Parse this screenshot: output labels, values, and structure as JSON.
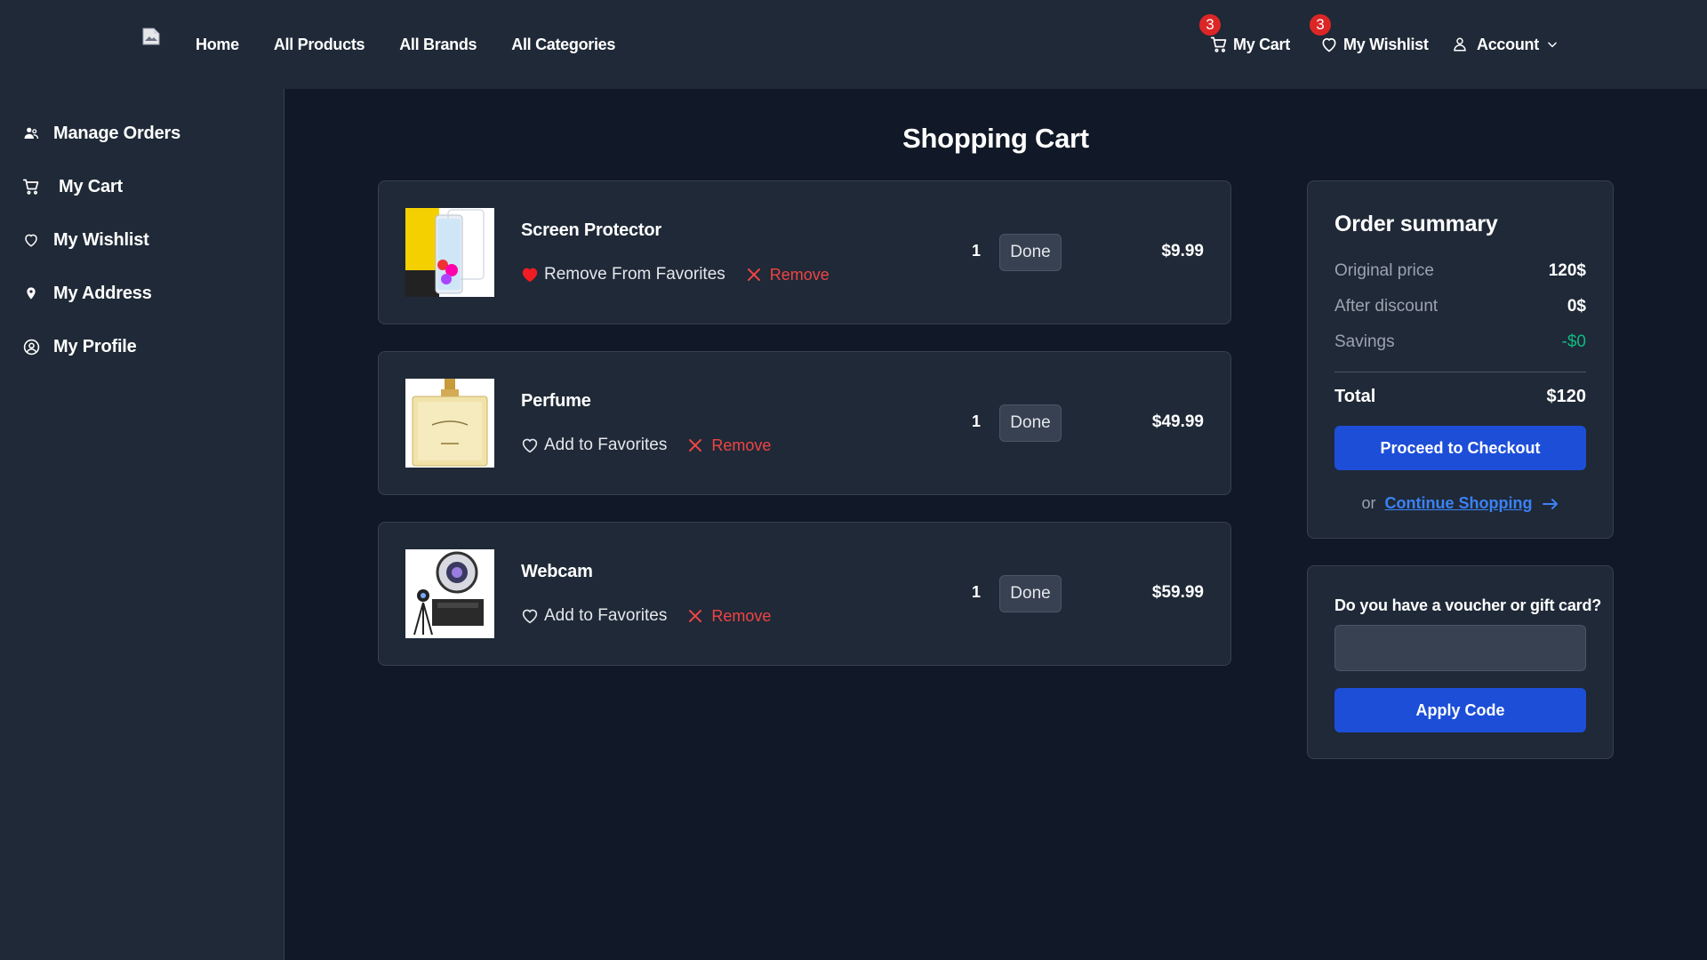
{
  "topnav": {
    "logo_icon": "broken-image-icon",
    "links": [
      "Home",
      "All Products",
      "All Brands",
      "All Categories"
    ],
    "cart": {
      "label": "My Cart",
      "badge": "3",
      "icon": "cart-icon"
    },
    "wishlist": {
      "label": "My Wishlist",
      "badge": "3",
      "icon": "heart-icon"
    },
    "account": {
      "label": "Account",
      "icon": "user-icon"
    }
  },
  "sidebar": {
    "items": [
      {
        "label": "Manage Orders",
        "icon": "users-icon"
      },
      {
        "label": "My Cart",
        "icon": "cart-icon"
      },
      {
        "label": "My Wishlist",
        "icon": "heart-icon"
      },
      {
        "label": "My Address",
        "icon": "location-pin-icon"
      },
      {
        "label": "My Profile",
        "icon": "user-circle-icon"
      }
    ]
  },
  "main": {
    "title": "Shopping Cart",
    "items": [
      {
        "name": "Screen Protector",
        "fav_label": "Remove From Favorites",
        "favorited": true,
        "remove_label": "Remove",
        "qty": "1",
        "done_label": "Done",
        "price": "$9.99"
      },
      {
        "name": "Perfume",
        "fav_label": "Add to Favorites",
        "favorited": false,
        "remove_label": "Remove",
        "qty": "1",
        "done_label": "Done",
        "price": "$49.99"
      },
      {
        "name": "Webcam",
        "fav_label": "Add to Favorites",
        "favorited": false,
        "remove_label": "Remove",
        "qty": "1",
        "done_label": "Done",
        "price": "$59.99"
      }
    ]
  },
  "summary": {
    "title": "Order summary",
    "original_label": "Original price",
    "original_value": "120$",
    "after_label": "After discount",
    "after_value": "0$",
    "savings_label": "Savings",
    "savings_value": "-$0",
    "total_label": "Total",
    "total_value": "$120",
    "checkout_label": "Proceed to Checkout",
    "or_text": "or",
    "continue_label": "Continue Shopping"
  },
  "voucher": {
    "label": "Do you have a voucher or gift card?",
    "input_value": "",
    "apply_label": "Apply Code"
  },
  "colors": {
    "page_bg": "#111827",
    "panel_bg": "#1f2937",
    "accent": "#1d4ed8",
    "danger": "#ef4444",
    "savings": "#10b981"
  }
}
